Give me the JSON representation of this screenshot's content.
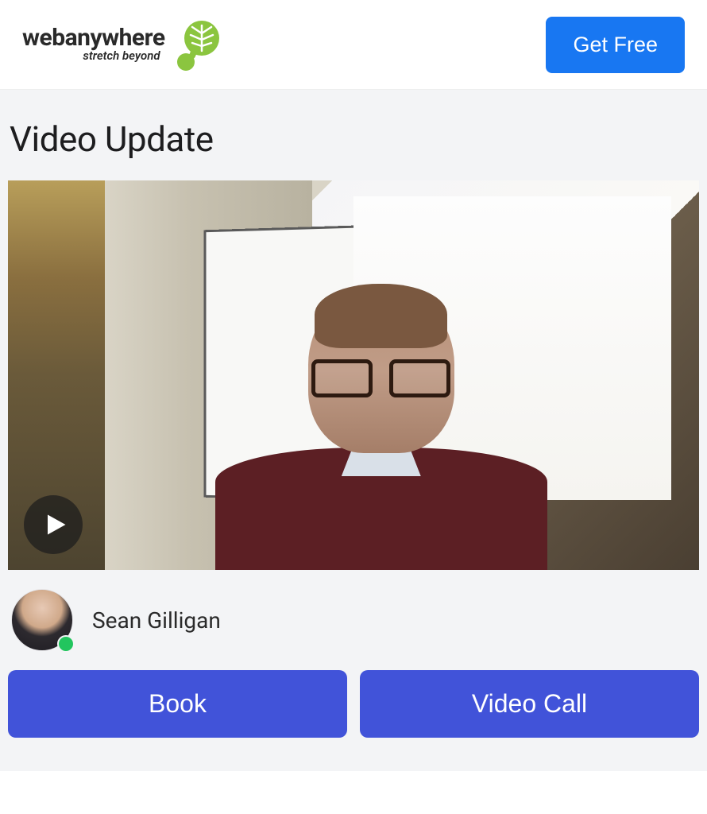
{
  "header": {
    "logo_text": "webanywhere",
    "logo_tagline": "stretch beyond",
    "cta_label": "Get Free"
  },
  "page": {
    "title": "Video Update"
  },
  "author": {
    "name": "Sean Gilligan",
    "presence": "online"
  },
  "actions": {
    "book_label": "Book",
    "video_call_label": "Video Call"
  },
  "colors": {
    "primary": "#1877f2",
    "action": "#4153d9",
    "presence_online": "#22c55e"
  }
}
